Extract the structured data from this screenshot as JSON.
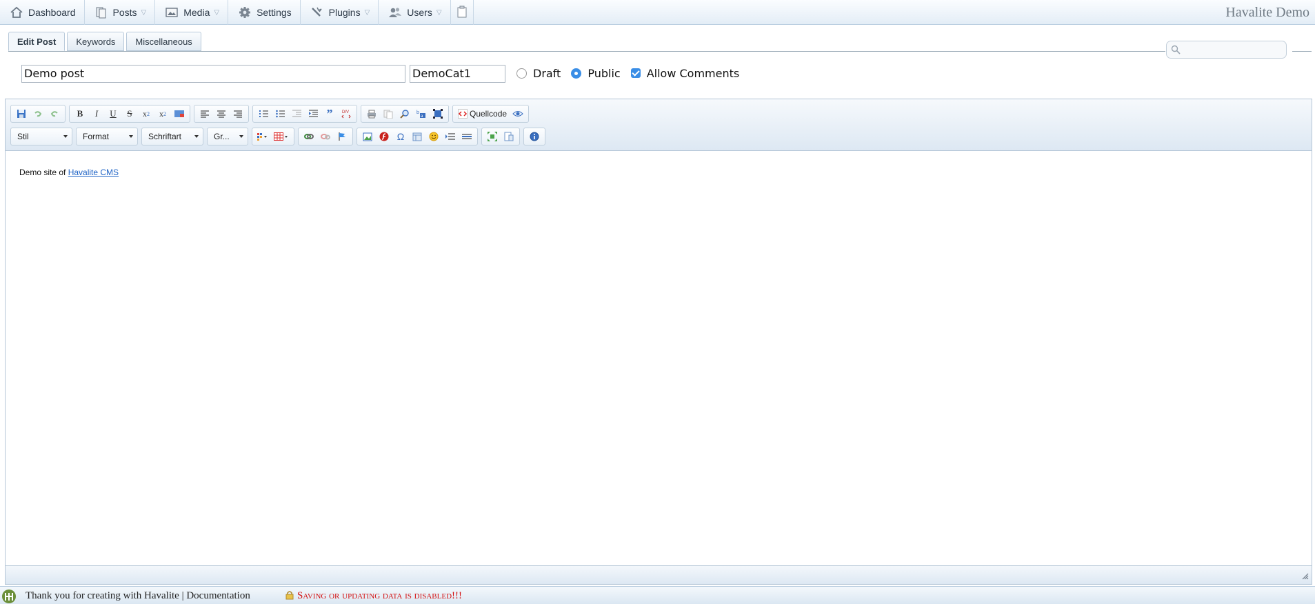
{
  "nav": {
    "items": [
      {
        "label": "Dashboard",
        "icon": "home-icon",
        "dropdown": false
      },
      {
        "label": "Posts",
        "icon": "posts-icon",
        "dropdown": true
      },
      {
        "label": "Media",
        "icon": "media-icon",
        "dropdown": true
      },
      {
        "label": "Settings",
        "icon": "gear-icon",
        "dropdown": false
      },
      {
        "label": "Plugins",
        "icon": "plugin-icon",
        "dropdown": true
      },
      {
        "label": "Users",
        "icon": "users-icon",
        "dropdown": true
      }
    ],
    "brand": "Havalite Demo"
  },
  "tabs": [
    {
      "label": "Edit Post",
      "active": true
    },
    {
      "label": "Keywords",
      "active": false
    },
    {
      "label": "Miscellaneous",
      "active": false
    }
  ],
  "post": {
    "title": "Demo post",
    "category": "DemoCat1",
    "options": {
      "draft_label": "Draft",
      "public_label": "Public",
      "comments_label": "Allow Comments",
      "status": "Public",
      "allow_comments": true
    }
  },
  "editor": {
    "source_label": "Quellcode",
    "combos": {
      "style": "Stil",
      "format": "Format",
      "font": "Schriftart",
      "size": "Gr..."
    },
    "content": {
      "text": "Demo site of",
      "link_text": "Havalite CMS"
    }
  },
  "footer": {
    "thanks": "Thank you for creating with Havalite | Documentation",
    "warning": "Saving or updating data is disabled!!!"
  },
  "colors": {
    "accent": "#3a8ee6",
    "link": "#1d62c5",
    "warning": "#d30f0f",
    "bar_bg": "#e3edf6"
  }
}
